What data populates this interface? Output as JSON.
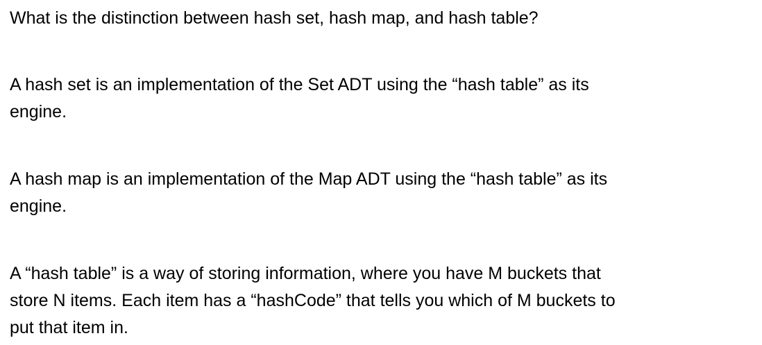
{
  "question": "What is the distinction between hash set, hash map, and hash table?",
  "paragraphs": [
    {
      "lines": [
        "A hash set is an implementation of the Set ADT using the “hash table” as its",
        "engine."
      ]
    },
    {
      "lines": [
        "A hash map is an implementation of the Map ADT using the “hash table” as its",
        "engine."
      ]
    },
    {
      "lines": [
        "A “hash table” is a way of storing information, where you have M buckets that",
        "store N items. Each item has a “hashCode” that tells you which of M buckets to",
        "put that item in."
      ]
    }
  ]
}
